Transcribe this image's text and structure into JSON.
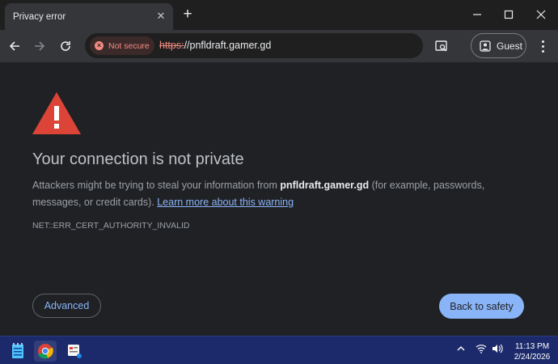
{
  "browser": {
    "tab": {
      "title": "Privacy error"
    },
    "toolbar": {
      "security_chip": "Not secure",
      "url_scheme": "https:",
      "url_rest": "//pnfldraft.gamer.gd",
      "profile_label": "Guest"
    }
  },
  "page": {
    "heading": "Your connection is not private",
    "body_prefix": "Attackers might be trying to steal your information from ",
    "domain": "pnfldraft.gamer.gd",
    "body_suffix": " (for example, passwords, messages, or credit cards). ",
    "learn_more": "Learn more about this warning",
    "error_code": "NET::ERR_CERT_AUTHORITY_INVALID",
    "advanced_button": "Advanced",
    "back_button": "Back to safety"
  },
  "taskbar": {
    "time": "11:13 PM",
    "date": "2/24/2026"
  },
  "colors": {
    "accent": "#8ab4f8",
    "warning_red": "#db4437",
    "not_secure": "#f28b82",
    "taskbar": "#1c2a6b"
  },
  "icons": [
    "close-icon",
    "plus-icon",
    "minimize-icon",
    "maximize-icon",
    "back-icon",
    "forward-icon",
    "reload-icon",
    "not-secure-icon",
    "search-tab-icon",
    "profile-icon",
    "more-icon",
    "warning-icon",
    "notepad-icon",
    "chrome-icon",
    "app-icon",
    "chevron-up-icon",
    "wifi-icon",
    "volume-icon"
  ]
}
